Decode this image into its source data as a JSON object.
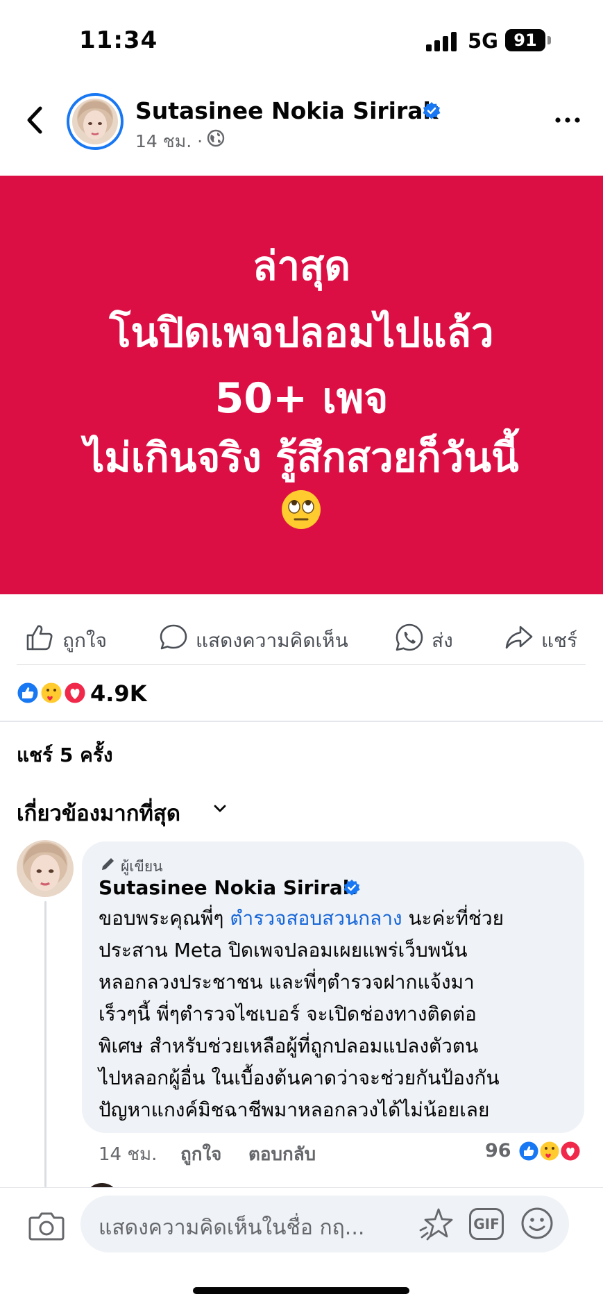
{
  "status_bar": {
    "time": "11:34",
    "network": "5G",
    "battery": "91"
  },
  "post": {
    "author": "Sutasinee Nokia Sirirak",
    "time": "14 ชม. ·",
    "banner_lines": [
      "ล่าสุด",
      "โนปิดเพจปลอมไปแล้ว",
      "50+ เพจ",
      "ไม่เกินจริง รู้สึกสวยก็วันนี้"
    ],
    "banner_emoji": "face-with-rolling-eyes",
    "colors": {
      "banner": "#dc0f45",
      "accent": "#1877f2",
      "link": "#1565d8"
    }
  },
  "actions": {
    "like": "ถูกใจ",
    "comment": "แสดงความคิดเห็น",
    "send": "ส่ง",
    "share": "แชร์"
  },
  "reactions": {
    "count": "4.9K",
    "icons": [
      "like-icon",
      "care-icon",
      "love-icon"
    ]
  },
  "shares": "แชร์ 5 ครั้ง",
  "sort": "เกี่ยวข้องมากที่สุด",
  "comment": {
    "badge": "ผู้เขียน",
    "author": "Sutasinee Nokia Sirirak",
    "line1_before": "ขอบพระคุณพี่ๆ ",
    "mention": "ตำรวจสอบสวนกลาง",
    "line1_after": " นะค่ะที่ช่วย",
    "lines": [
      "ประสาน Meta ปิดเพจปลอมเผยแพร่เว็บพนัน",
      "หลอกลวงประชาชน และพี่ๆตำรวจฝากแจ้งมา",
      "เร็วๆนี้ พี่ๆตำรวจไซเบอร์ จะเปิดช่องทางติดต่อ",
      "พิเศษ สำหรับช่วยเหลือผู้ที่ถูกปลอมแปลงตัวตน",
      "ไปหลอกผู้อื่น ในเบื้องต้นคาดว่าจะช่วยกันป้องกัน",
      "ปัญหาแกงค์มิชฉาชีพมาหลอกลวงได้ไม่น้อยเลย"
    ],
    "time": "14 ชม.",
    "like": "ถูกใจ",
    "reply": "ตอบกลับ",
    "reaction_count": "96"
  },
  "composer": {
    "placeholder": "แสดงความคิดเห็นในชื่อ กฤ...",
    "gif": "GIF"
  }
}
